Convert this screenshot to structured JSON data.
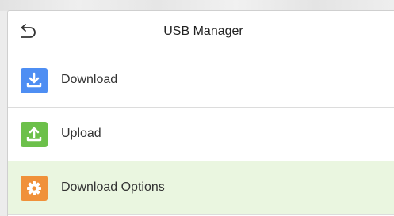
{
  "header": {
    "back_icon": "back-arrow-icon",
    "title": "USB Manager"
  },
  "menu": {
    "items": [
      {
        "label": "Download",
        "icon": "download-icon",
        "color": "#4e8ef3"
      },
      {
        "label": "Upload",
        "icon": "upload-icon",
        "color": "#6cc04a"
      },
      {
        "label": "Download Options",
        "icon": "gear-icon",
        "color": "#f0913a",
        "selected": true
      }
    ]
  },
  "colors": {
    "selected_row_bg": "#eaf6e0",
    "divider": "#dcdcdc"
  }
}
